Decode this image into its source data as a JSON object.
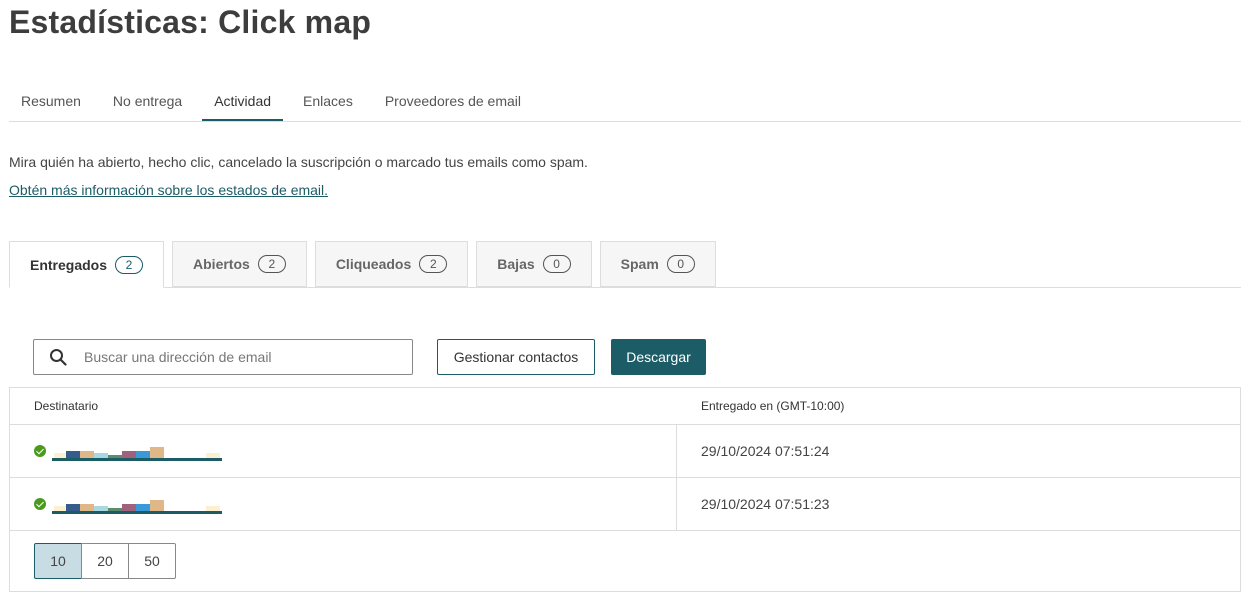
{
  "page": {
    "title": "Estadísticas: Click map"
  },
  "nav_tabs": [
    {
      "label": "Resumen",
      "active": false
    },
    {
      "label": "No entrega",
      "active": false
    },
    {
      "label": "Actividad",
      "active": true
    },
    {
      "label": "Enlaces",
      "active": false
    },
    {
      "label": "Proveedores de email",
      "active": false
    }
  ],
  "intro": {
    "text": "Mira quién ha abierto, hecho clic, cancelado la suscripción o marcado tus emails como spam.",
    "link": "Obtén más información sobre los estados de email."
  },
  "status_tabs": [
    {
      "label": "Entregados",
      "count": "2",
      "active": true
    },
    {
      "label": "Abiertos",
      "count": "2",
      "active": false
    },
    {
      "label": "Cliqueados",
      "count": "2",
      "active": false
    },
    {
      "label": "Bajas",
      "count": "0",
      "active": false
    },
    {
      "label": "Spam",
      "count": "0",
      "active": false
    }
  ],
  "search": {
    "placeholder": "Buscar una dirección de email",
    "value": ""
  },
  "actions": {
    "manage_label": "Gestionar contactos",
    "download_label": "Descargar"
  },
  "table": {
    "columns": [
      "Destinatario",
      "Entregado en (GMT-10:00)"
    ],
    "rows": [
      {
        "recipient": "",
        "status": "delivered",
        "date": "29/10/2024 07:51:24"
      },
      {
        "recipient": "",
        "status": "delivered",
        "date": "29/10/2024 07:51:23"
      }
    ]
  },
  "pagination": {
    "options": [
      "10",
      "20",
      "50"
    ],
    "selected": "10"
  },
  "colors": {
    "accent": "#1b5c66",
    "success": "#4a9a1e",
    "selected_page": "#c8dde3"
  }
}
